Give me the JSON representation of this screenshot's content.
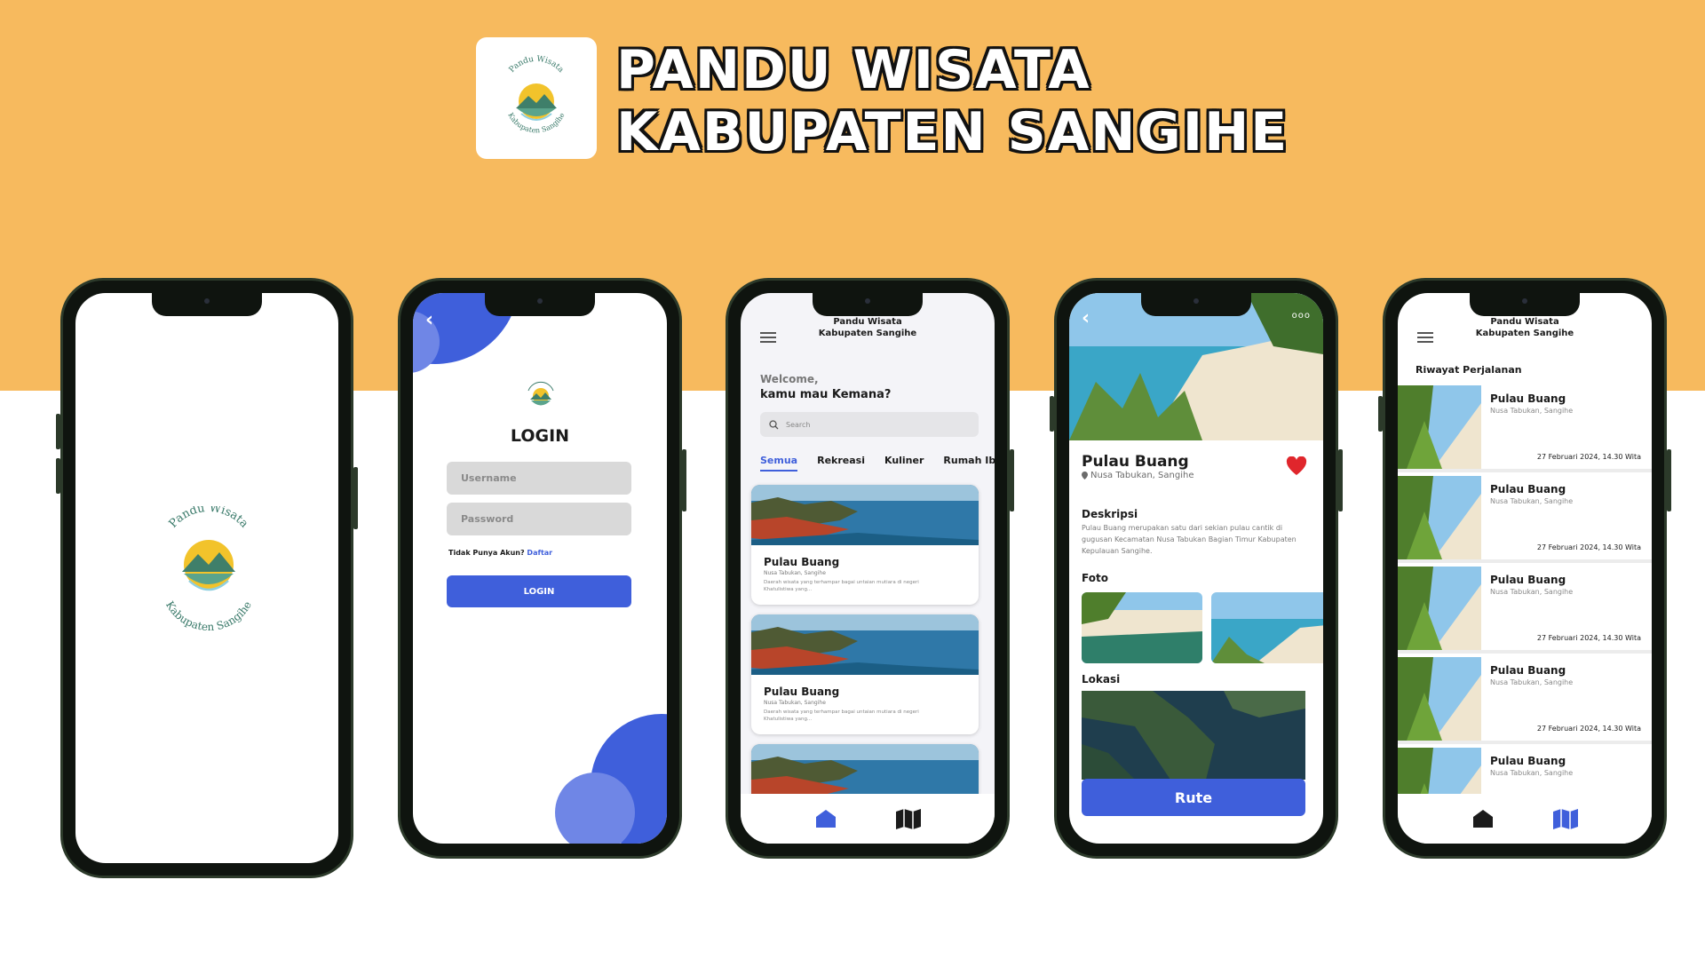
{
  "header": {
    "title_line1": "PANDU WISATA",
    "title_line2": "KABUPATEN SANGIHE",
    "logo_text_top": "Pandu Wisata",
    "logo_text_bottom": "Kabupaten Sangihe"
  },
  "colors": {
    "top_band": "#f7ba5e",
    "accent_blue": "#3f5fdb",
    "heart_red": "#e0262c",
    "logo_green": "#4a8f7a",
    "logo_yellow": "#f2c32b"
  },
  "splash": {
    "logo_text_top": "Pandu Wisata",
    "logo_text_bottom": "Kabupaten Sangihe"
  },
  "login": {
    "back_icon": "chevron-left-icon",
    "title": "LOGIN",
    "username_placeholder": "Username",
    "password_placeholder": "Password",
    "no_account_text": "Tidak Punya Akun?",
    "register_link": "Daftar",
    "login_button": "LOGIN"
  },
  "home": {
    "app_title_line1": "Pandu Wisata",
    "app_title_line2": "Kabupaten Sangihe",
    "welcome": "Welcome,",
    "question": "kamu mau Kemana?",
    "search_placeholder": "Search",
    "tabs": [
      "Semua",
      "Rekreasi",
      "Kuliner",
      "Rumah Ibad"
    ],
    "cards": [
      {
        "title": "Pulau Buang",
        "location": "Nusa Tabukan, Sangihe",
        "desc": "Daerah wisata yang terhampar bagai untaian mutiara di negeri Khatulistiwa yang..."
      },
      {
        "title": "Pulau Buang",
        "location": "Nusa Tabukan, Sangihe",
        "desc": "Daerah wisata yang terhampar bagai untaian mutiara di negeri Khatulistiwa yang..."
      }
    ],
    "nav": [
      "home-icon",
      "map-icon"
    ]
  },
  "detail": {
    "more_label": "ooo",
    "title": "Pulau Buang",
    "location": "Nusa Tabukan, Sangihe",
    "desc_heading": "Deskripsi",
    "description": "Pulau Buang merupakan satu dari sekian pulau cantik di gugusan Kecamatan Nusa Tabukan Bagian Timur Kabupaten Kepulauan Sangihe.",
    "foto_heading": "Foto",
    "lokasi_heading": "Lokasi",
    "route_button": "Rute",
    "favorite": true
  },
  "history": {
    "app_title_line1": "Pandu Wisata",
    "app_title_line2": "Kabupaten Sangihe",
    "heading": "Riwayat Perjalanan",
    "items": [
      {
        "title": "Pulau Buang",
        "location": "Nusa Tabukan, Sangihe",
        "date": "27 Februari 2024, 14.30 Wita"
      },
      {
        "title": "Pulau Buang",
        "location": "Nusa Tabukan, Sangihe",
        "date": "27 Februari 2024, 14.30 Wita"
      },
      {
        "title": "Pulau Buang",
        "location": "Nusa Tabukan, Sangihe",
        "date": "27 Februari 2024, 14.30 Wita"
      },
      {
        "title": "Pulau Buang",
        "location": "Nusa Tabukan, Sangihe",
        "date": "27 Februari 2024, 14.30 Wita"
      },
      {
        "title": "Pulau Buang",
        "location": "Nusa Tabukan, Sangihe",
        "date": ""
      }
    ],
    "nav": [
      "home-icon",
      "map-icon"
    ]
  }
}
